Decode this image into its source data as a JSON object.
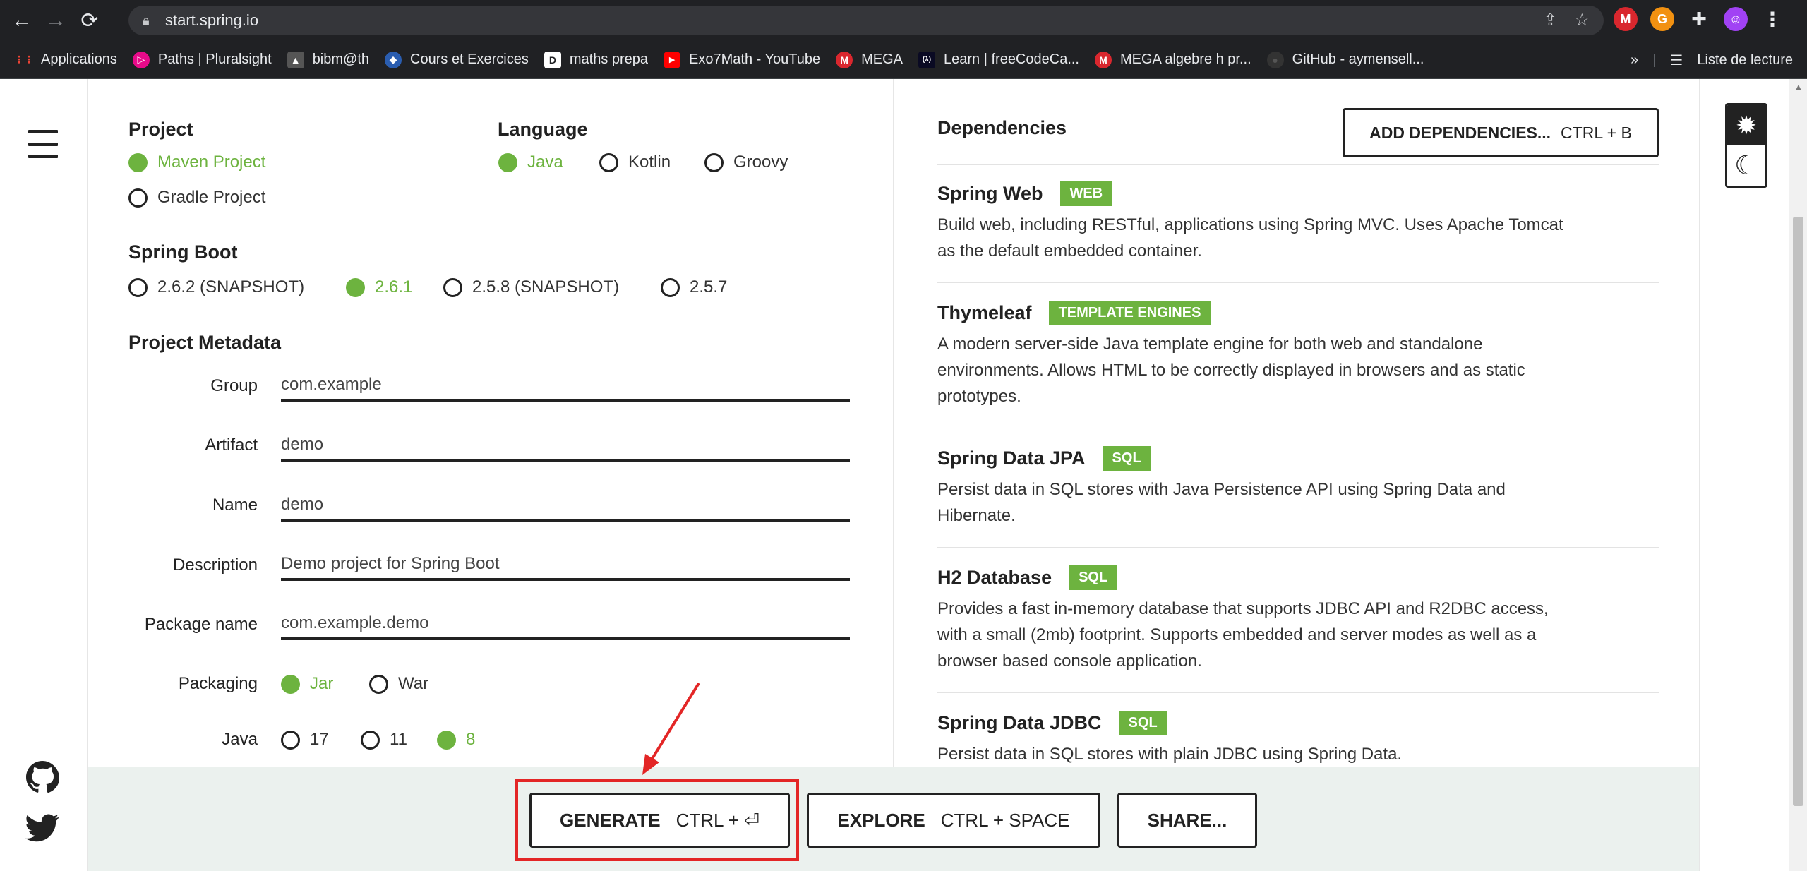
{
  "browser": {
    "url": "start.spring.io",
    "bookmarks": [
      {
        "label": "Applications",
        "icon": "apps-grid-icon",
        "color": "#4285f4"
      },
      {
        "label": "Paths | Pluralsight",
        "icon": "pluralsight-icon",
        "color": "#e80a89"
      },
      {
        "label": "bibm@th",
        "icon": "bibmath-icon",
        "color": "#555555"
      },
      {
        "label": "Cours et Exercices",
        "icon": "cours-icon",
        "color": "#2a5db0"
      },
      {
        "label": "maths prepa",
        "icon": "maths-prepa-icon",
        "color": "#ffffff"
      },
      {
        "label": "Exo7Math - YouTube",
        "icon": "youtube-icon",
        "color": "#ff0000"
      },
      {
        "label": "MEGA",
        "icon": "mega-icon",
        "color": "#d9272e"
      },
      {
        "label": "Learn | freeCodeCa...",
        "icon": "freecodecamp-icon",
        "color": "#0a0a23"
      },
      {
        "label": "MEGA algebre h pr...",
        "icon": "mega-icon",
        "color": "#d9272e"
      },
      {
        "label": "GitHub - aymensell...",
        "icon": "github-icon",
        "color": "#333333"
      }
    ],
    "more_label": "»",
    "reading_list": "Liste de lecture"
  },
  "project": {
    "title": "Project",
    "options": [
      "Maven Project",
      "Gradle Project"
    ],
    "selected": "Maven Project"
  },
  "language": {
    "title": "Language",
    "options": [
      "Java",
      "Kotlin",
      "Groovy"
    ],
    "selected": "Java"
  },
  "spring_boot": {
    "title": "Spring Boot",
    "options": [
      "2.6.2 (SNAPSHOT)",
      "2.6.1",
      "2.5.8 (SNAPSHOT)",
      "2.5.7"
    ],
    "selected": "2.6.1"
  },
  "metadata": {
    "title": "Project Metadata",
    "fields": [
      {
        "label": "Group",
        "value": "com.example"
      },
      {
        "label": "Artifact",
        "value": "demo"
      },
      {
        "label": "Name",
        "value": "demo"
      },
      {
        "label": "Description",
        "value": "Demo project for Spring Boot"
      },
      {
        "label": "Package name",
        "value": "com.example.demo"
      }
    ],
    "packaging": {
      "label": "Packaging",
      "options": [
        "Jar",
        "War"
      ],
      "selected": "Jar"
    },
    "java": {
      "label": "Java",
      "options": [
        "17",
        "11",
        "8"
      ],
      "selected": "8"
    }
  },
  "dependencies": {
    "title": "Dependencies",
    "add_button": {
      "label": "ADD DEPENDENCIES...",
      "shortcut": "CTRL + B"
    },
    "items": [
      {
        "name": "Spring Web",
        "tag": "WEB",
        "desc_lines": [
          "Build web, including RESTful, applications using Spring MVC. Uses Apache Tomcat",
          "as the default embedded container."
        ]
      },
      {
        "name": "Thymeleaf",
        "tag": "TEMPLATE ENGINES",
        "desc_lines": [
          "A modern server-side Java template engine for both web and standalone",
          "environments. Allows HTML to be correctly displayed in browsers and as static",
          "prototypes."
        ]
      },
      {
        "name": "Spring Data JPA",
        "tag": "SQL",
        "desc_lines": [
          "Persist data in SQL stores with Java Persistence API using Spring Data and",
          "Hibernate."
        ]
      },
      {
        "name": "H2 Database",
        "tag": "SQL",
        "desc_lines": [
          "Provides a fast in-memory database that supports JDBC API and R2DBC access,",
          "with a small (2mb) footprint. Supports embedded and server modes as well as a",
          "browser based console application."
        ]
      },
      {
        "name": "Spring Data JDBC",
        "tag": "SQL",
        "desc_lines": [
          "Persist data in SQL stores with plain JDBC using Spring Data."
        ]
      }
    ]
  },
  "actions": {
    "generate": {
      "label": "GENERATE",
      "shortcut": "CTRL + ⏎"
    },
    "explore": {
      "label": "EXPLORE",
      "shortcut": "CTRL + SPACE"
    },
    "share": {
      "label": "SHARE..."
    }
  },
  "colors": {
    "accent": "#6db33f",
    "highlight": "#e32626"
  }
}
